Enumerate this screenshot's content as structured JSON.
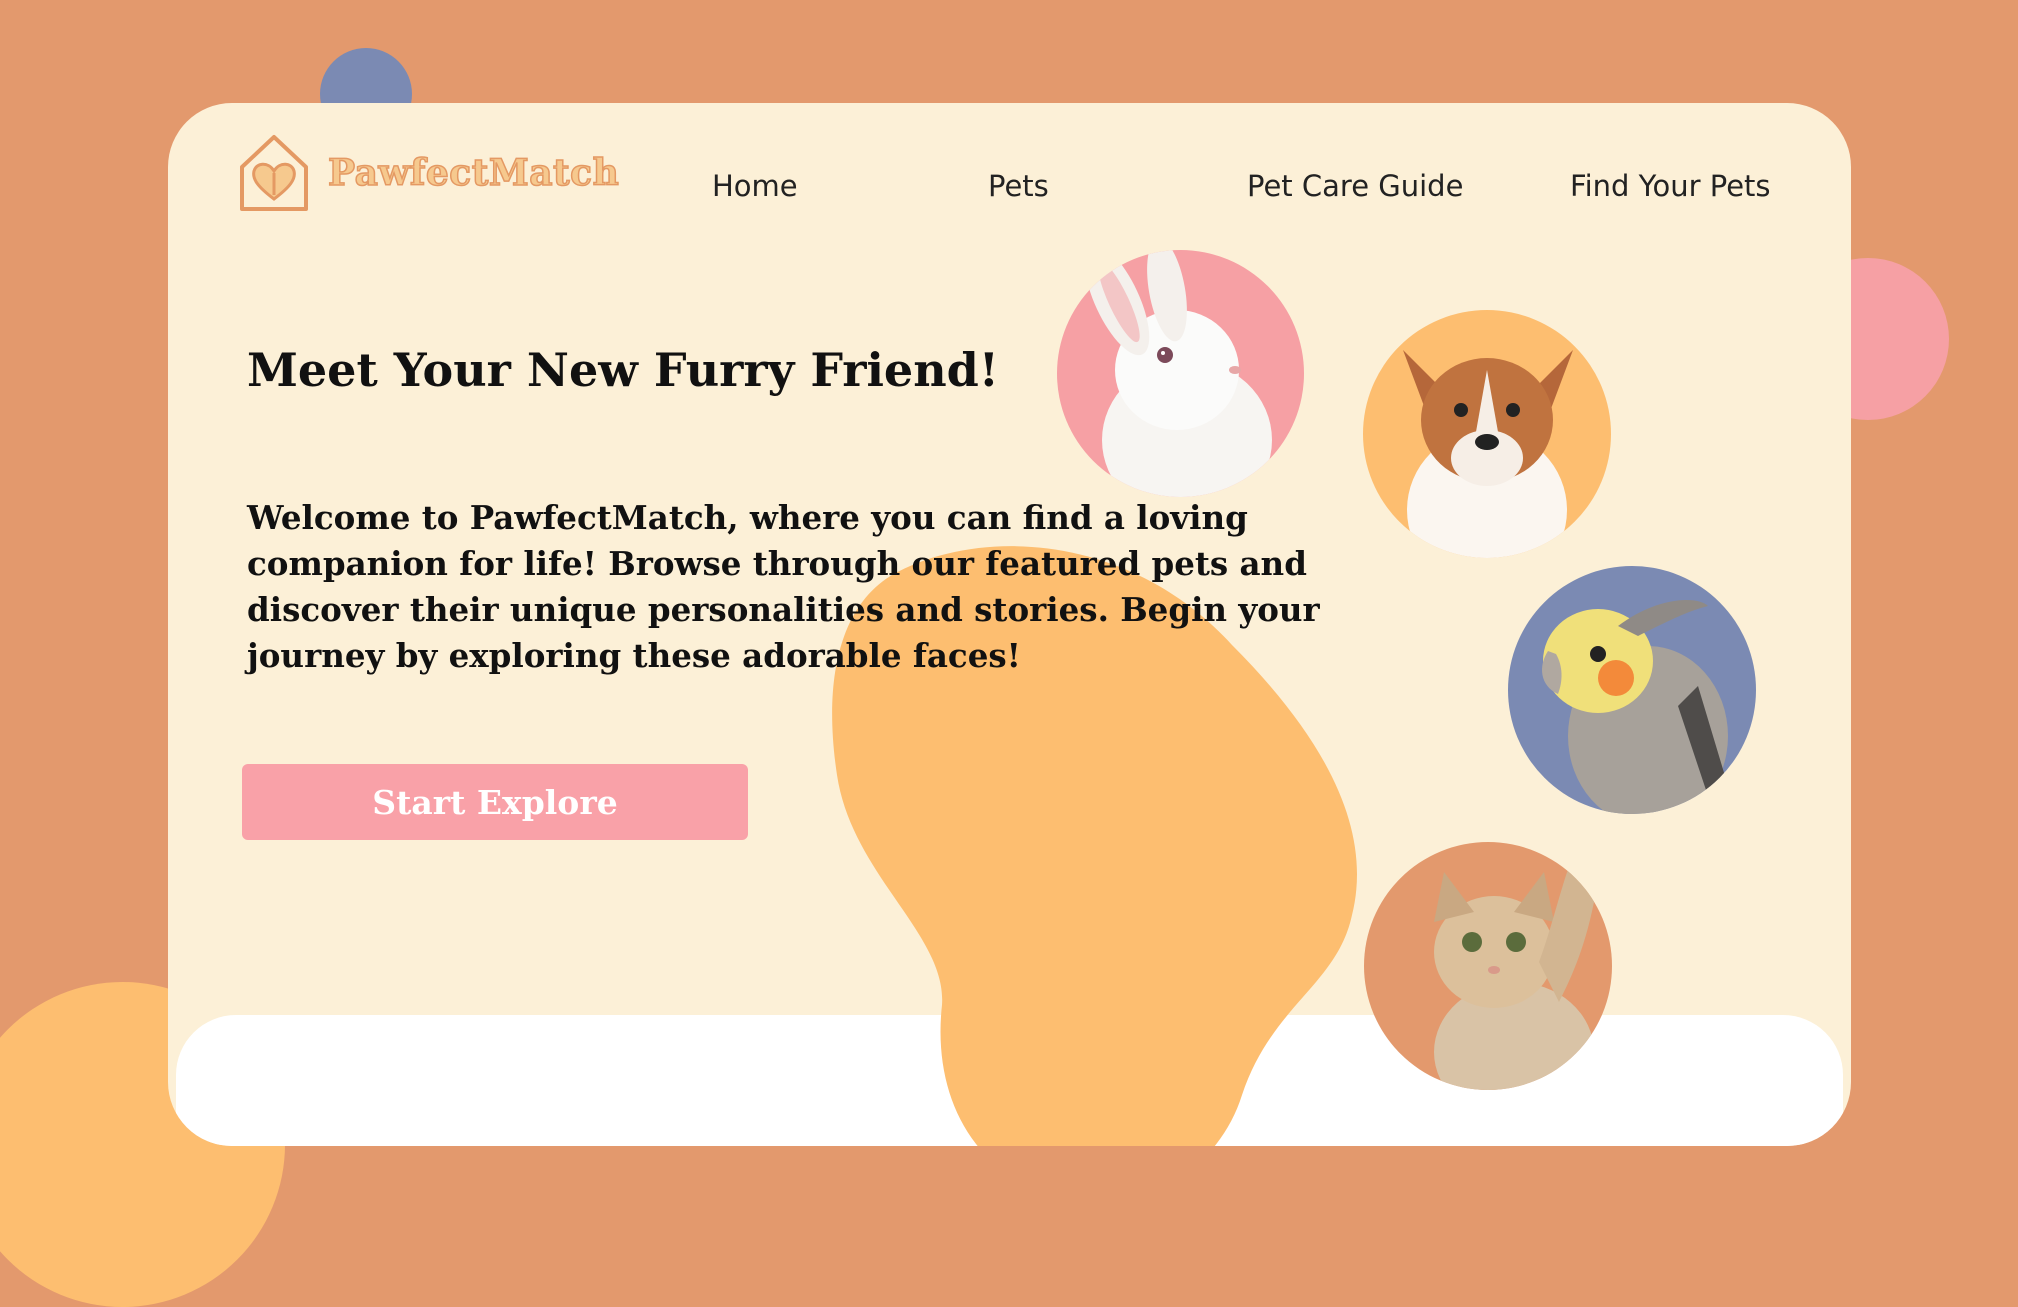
{
  "brand": {
    "name": "PawfectMatch",
    "logo_icon": "house-heart-icon",
    "colors": {
      "primary": "#e49963",
      "accent_fill": "#f6c98e"
    }
  },
  "nav": {
    "items": [
      "Home",
      "Pets",
      "Pet Care Guide",
      "Find Your Pets"
    ]
  },
  "hero": {
    "title": "Meet Your New Furry Friend!",
    "text": "Welcome to PawfectMatch, where you can find a loving companion for life! Browse through our featured pets and discover their unique personalities and stories. Begin your journey by exploring these adorable faces!",
    "cta_label": "Start Explore",
    "cta_color": "#f9a1a8"
  },
  "pets": [
    {
      "name": "rabbit",
      "circle_color": "#f6a0a4"
    },
    {
      "name": "corgi",
      "circle_color": "#fdbe70"
    },
    {
      "name": "cockatiel",
      "circle_color": "#7b8ab3"
    },
    {
      "name": "kitten",
      "circle_color": "#e3996d"
    }
  ],
  "theme": {
    "background": "#e3996d",
    "card": "#fcf0d7",
    "blob": "#fdbe70",
    "blue": "#7b8ab3",
    "pink": "#f6a0a4"
  }
}
